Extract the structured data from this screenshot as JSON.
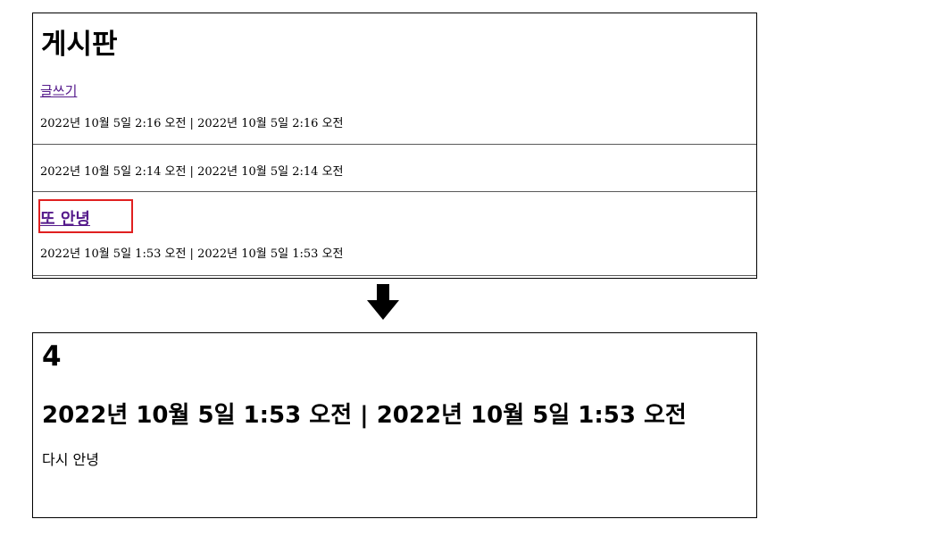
{
  "board": {
    "title": "게시판",
    "write_link": "글쓰기",
    "posts": [
      {
        "title": "",
        "dates": "2022년 10월 5일 2:16 오전 | 2022년 10월 5일 2:16 오전"
      },
      {
        "title": "",
        "dates": "2022년 10월 5일 2:14 오전 | 2022년 10월 5일 2:14 오전"
      },
      {
        "title": "또 안녕",
        "dates": "2022년 10월 5일 1:53 오전 | 2022년 10월 5일 1:53 오전"
      }
    ]
  },
  "arrow_icon": "down-arrow-icon",
  "highlight_color": "#e02020",
  "link_color": "#551a8b",
  "detail": {
    "id": "4",
    "dates": "2022년 10월 5일 1:53 오전 | 2022년 10월 5일 1:53 오전",
    "content": "다시 안녕"
  }
}
